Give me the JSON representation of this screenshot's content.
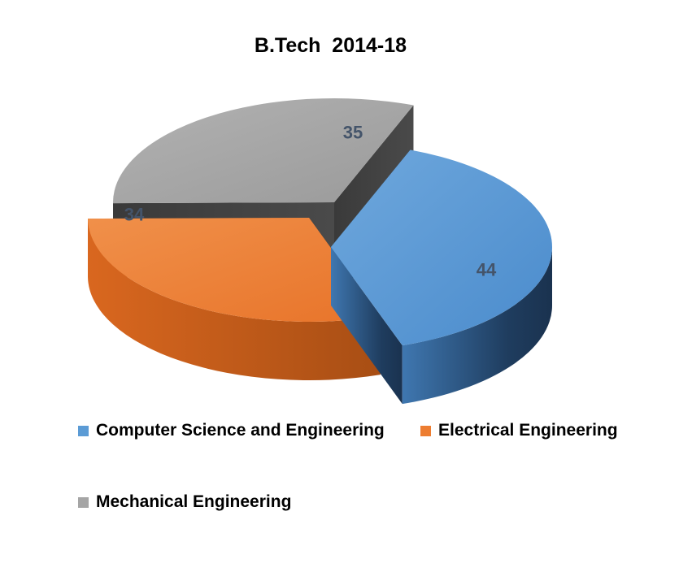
{
  "chart_data": {
    "type": "pie",
    "title": "B.Tech  2014-18",
    "categories": [
      "Computer Science and Engineering",
      "Electrical Engineering",
      "Mechanical Engineering"
    ],
    "values": [
      44,
      34,
      35
    ],
    "colors": [
      "#5b9bd5",
      "#ed7d31",
      "#a5a5a5"
    ],
    "exploded": true,
    "three_d": true,
    "data_labels": true,
    "legend_position": "bottom"
  }
}
